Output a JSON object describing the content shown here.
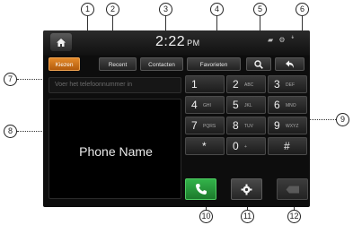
{
  "callouts": [
    "1",
    "2",
    "3",
    "4",
    "5",
    "6",
    "7",
    "8",
    "9",
    "10",
    "11",
    "12"
  ],
  "header": {
    "time": "2:22",
    "ampm": "PM",
    "status": "▰ ⚙ ꜜ"
  },
  "tabs": [
    {
      "label": "Kiezen",
      "active": true
    },
    {
      "label": "Recent",
      "active": false
    },
    {
      "label": "Contacten",
      "active": false
    },
    {
      "label": "Favorieten",
      "active": false
    }
  ],
  "number_input": {
    "placeholder": "Voer het telefoonnummer in"
  },
  "phone": {
    "name": "Phone Name"
  },
  "keypad": [
    {
      "digit": "1",
      "letters": ""
    },
    {
      "digit": "2",
      "letters": "ABC"
    },
    {
      "digit": "3",
      "letters": "DEF"
    },
    {
      "digit": "4",
      "letters": "GHI"
    },
    {
      "digit": "5",
      "letters": "JKL"
    },
    {
      "digit": "6",
      "letters": "MNO"
    },
    {
      "digit": "7",
      "letters": "PQRS"
    },
    {
      "digit": "8",
      "letters": "TUV"
    },
    {
      "digit": "9",
      "letters": "WXYZ"
    },
    {
      "digit": "*",
      "letters": ""
    },
    {
      "digit": "0",
      "letters": "+"
    },
    {
      "digit": "#",
      "letters": ""
    }
  ],
  "icons": [
    "home-icon",
    "search-icon",
    "back-icon",
    "phone-icon",
    "gear-icon",
    "delete-icon"
  ],
  "colors": {
    "accent": "#e48a2a",
    "call": "#2a9a3d",
    "background": "#0d0d0d"
  }
}
